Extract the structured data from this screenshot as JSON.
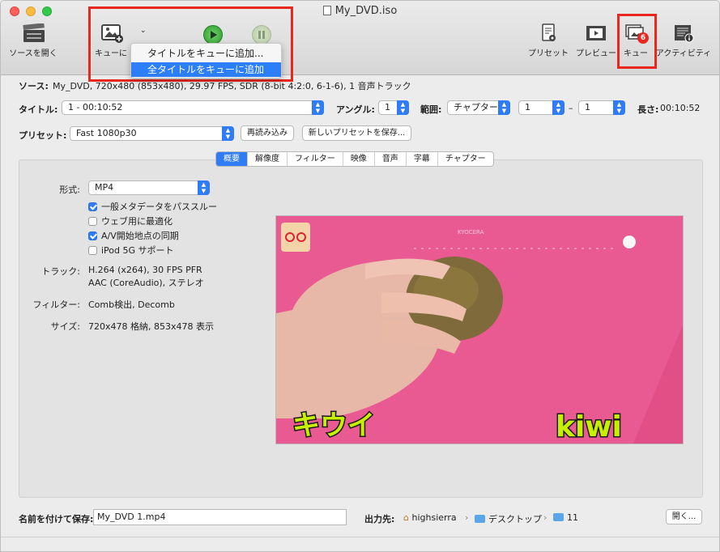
{
  "window": {
    "title": "My_DVD.iso"
  },
  "toolbar": {
    "open_source": "ソースを開く",
    "add_queue": "キューに",
    "presets": "プリセット",
    "preview": "プレビュー",
    "queue": "キュー",
    "activity": "アクティビティ",
    "queue_badge": "6"
  },
  "menu": {
    "items": [
      "タイトルをキューに追加...",
      "全タイトルをキューに追加"
    ]
  },
  "source": {
    "label": "ソース:",
    "value": "My_DVD, 720x480 (853x480), 29.97 FPS, SDR (8-bit 4:2:0, 6-1-6), 1 音声トラック"
  },
  "title_row": {
    "title_label": "タイトル:",
    "title_value": "1 - 00:10:52",
    "angle_label": "アングル:",
    "angle_value": "1",
    "range_label": "範囲:",
    "range_type": "チャプター",
    "range_from": "1",
    "range_dash": "–",
    "range_to": "1",
    "duration_label": "長さ:",
    "duration_value": "00:10:52"
  },
  "preset_row": {
    "label": "プリセット:",
    "value": "Fast 1080p30",
    "reload": "再読み込み",
    "save_new": "新しいプリセットを保存..."
  },
  "tabs": [
    "概要",
    "解像度",
    "フィルター",
    "映像",
    "音声",
    "字幕",
    "チャプター"
  ],
  "summary": {
    "format_label": "形式:",
    "format_value": "MP4",
    "checkboxes": [
      {
        "label": "一般メタデータをパススルー",
        "checked": true
      },
      {
        "label": "ウェブ用に最適化",
        "checked": false
      },
      {
        "label": "A/V開始地点の同期",
        "checked": true
      },
      {
        "label": "iPod 5G サポート",
        "checked": false
      }
    ],
    "tracks_label": "トラック:",
    "tracks_line1": "H.264 (x264), 30 FPS PFR",
    "tracks_line2": "AAC (CoreAudio), ステレオ",
    "filters_label": "フィルター:",
    "filters_value": "Comb検出, Decomb",
    "size_label": "サイズ:",
    "size_value": "720x478 格納, 853x478 表示"
  },
  "preview_image": {
    "caption_left": "キウイ",
    "caption_right": "kiwi",
    "brand": "KYOCERA"
  },
  "save": {
    "label": "名前を付けて保存:",
    "value": "My_DVD 1.mp4",
    "dest_label": "出力先:",
    "path": [
      "highsierra",
      "デスクトップ",
      "11"
    ],
    "open_button": "開く..."
  },
  "colors": {
    "accent": "#2f7cf6",
    "highlight_box": "#e8281f",
    "badge": "#e8281f"
  }
}
